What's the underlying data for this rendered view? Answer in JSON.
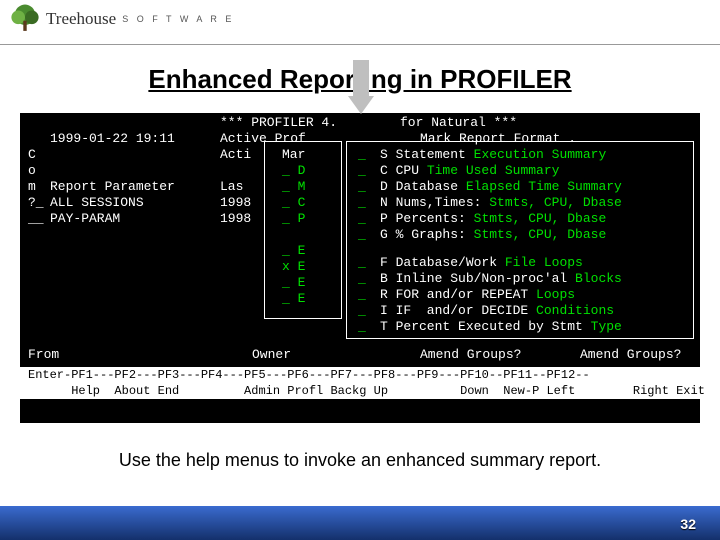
{
  "logo": {
    "brand": "Treehouse",
    "sub": "S O F T W A R E"
  },
  "title": "Enhanced Reporting in PROFILER",
  "terminal": {
    "banner_left": "*** PROFILER 4.",
    "banner_right": "for Natural ***",
    "line2_a": "1999-01-22 19:11",
    "line2_b": "Active Prof",
    "line2_c": "Mark Report Format .",
    "left_col": {
      "c": "C",
      "o": "o",
      "m": "m",
      "q": "?_",
      "u": "__",
      "report_param": "Report Parameter",
      "all_sessions": "ALL SESSIONS",
      "pay_param": "PAY-PARAM"
    },
    "mid_col": {
      "acti": "Acti",
      "las": "Las",
      "y1": "1998",
      "y2": "1998",
      "mar": "Mar"
    },
    "menu1": {
      "d": "_ D",
      "m": "_ M",
      "c": "_ C",
      "p": "_ P",
      "e1": "_ E",
      "e2": "x E",
      "e3": "_ E",
      "e4": "_ E"
    },
    "right": {
      "s": "S Statement",
      "s2": "Execution Summary",
      "c": "C CPU",
      "c2": "Time Used Summary",
      "d": "D Database",
      "d2": "Elapsed Time Summary",
      "n": "N Nums,Times:",
      "n2": "Stmts, CPU, Dbase",
      "p": "P Percents:",
      "p2": "Stmts, CPU, Dbase",
      "g": "G % Graphs:",
      "g2": "Stmts, CPU, Dbase",
      "f": "F Database/Work",
      "f2": "File Loops",
      "b": "B Inline Sub/Non-proc'al",
      "b2": "Blocks",
      "r": "R FOR and/or REPEAT",
      "r2": "Loops",
      "i": "I IF  and/or DECIDE",
      "i2": "Conditions",
      "t": "T Percent Executed by Stmt",
      "t2": "Type"
    },
    "bottom": {
      "from": "From",
      "owner": "Owner",
      "ag1": "Amend Groups?",
      "ag2": "Amend Groups?"
    },
    "pf": {
      "line1": "Enter-PF1---PF2---PF3---PF4---PF5---PF6---PF7---PF8---PF9---PF10--PF11--PF12--",
      "line2": "      Help  About End         Admin Profl Backg Up          Down  New-P Left        Right Exit"
    }
  },
  "caption": "Use the help menus to invoke an enhanced summary report.",
  "page": "32"
}
